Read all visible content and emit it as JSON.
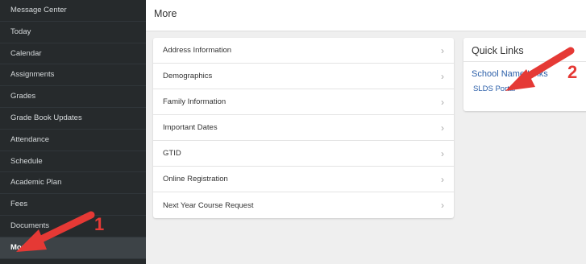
{
  "sidebar": {
    "items": [
      {
        "label": "Message Center"
      },
      {
        "label": "Today"
      },
      {
        "label": "Calendar"
      },
      {
        "label": "Assignments"
      },
      {
        "label": "Grades"
      },
      {
        "label": "Grade Book Updates"
      },
      {
        "label": "Attendance"
      },
      {
        "label": "Schedule"
      },
      {
        "label": "Academic Plan"
      },
      {
        "label": "Fees"
      },
      {
        "label": "Documents"
      },
      {
        "label": "More"
      }
    ]
  },
  "header": {
    "title": "More"
  },
  "menu": {
    "items": [
      {
        "label": "Address Information"
      },
      {
        "label": "Demographics"
      },
      {
        "label": "Family Information"
      },
      {
        "label": "Important Dates"
      },
      {
        "label": "GTID"
      },
      {
        "label": "Online Registration"
      },
      {
        "label": "Next Year Course Request"
      }
    ],
    "chevron": "›"
  },
  "quick_links": {
    "title": "Quick Links",
    "school_name": "School Name Links",
    "link": "SLDS Portal"
  },
  "annotations": {
    "first": "1",
    "second": "2",
    "color": "#e53935"
  }
}
